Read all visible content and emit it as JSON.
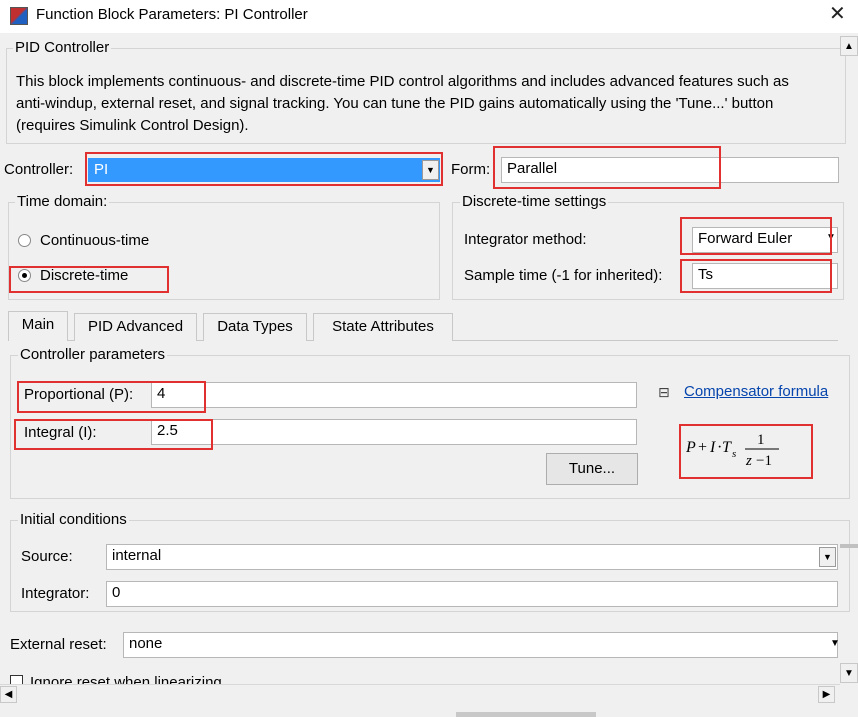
{
  "window": {
    "title": "Function Block Parameters: PI Controller",
    "close_glyph": "✕"
  },
  "block": {
    "group_label": "PID Controller",
    "description_lines": [
      "This block implements continuous- and discrete-time PID control algorithms and includes advanced features such as",
      "anti-windup, external reset, and signal tracking. You can tune the PID gains automatically using the 'Tune...' button",
      "(requires Simulink Control Design)."
    ]
  },
  "controller": {
    "label": "Controller:",
    "value": "PI"
  },
  "form": {
    "label": "Form:",
    "value": "Parallel"
  },
  "time_domain": {
    "label": "Time domain:",
    "options": [
      {
        "label": "Continuous-time",
        "selected": false
      },
      {
        "label": "Discrete-time",
        "selected": true
      }
    ]
  },
  "discrete_settings": {
    "label": "Discrete-time settings",
    "integrator_method_label": "Integrator method:",
    "integrator_method_value": "Forward Euler",
    "sample_time_label": "Sample time (-1 for inherited):",
    "sample_time_value": "Ts"
  },
  "tabs": [
    {
      "label": "Main",
      "active": true
    },
    {
      "label": "PID Advanced",
      "active": false
    },
    {
      "label": "Data Types",
      "active": false
    },
    {
      "label": "State Attributes",
      "active": false
    }
  ],
  "controller_params": {
    "label": "Controller parameters",
    "proportional_label": "Proportional (P):",
    "proportional_value": "4",
    "integral_label": "Integral (I):",
    "integral_value": "2.5",
    "tune_button": "Tune...",
    "collapse_glyph": "⊟",
    "formula_link": "Compensator formula"
  },
  "initial_conditions": {
    "label": "Initial conditions",
    "source_label": "Source:",
    "source_value": "internal",
    "integrator_label": "Integrator:",
    "integrator_value": "0"
  },
  "external_reset": {
    "label": "External reset:",
    "value": "none"
  },
  "ignore_reset": {
    "label": "Ignore reset when linearizing",
    "checked": false
  },
  "colors": {
    "highlight": "#3399ff",
    "annotation_red": "#e03030",
    "link": "#0645ad"
  },
  "icons": [
    "app-icon",
    "close-icon",
    "chevron-down-icon",
    "chevron-up-icon",
    "chevron-left-icon",
    "chevron-right-icon"
  ]
}
